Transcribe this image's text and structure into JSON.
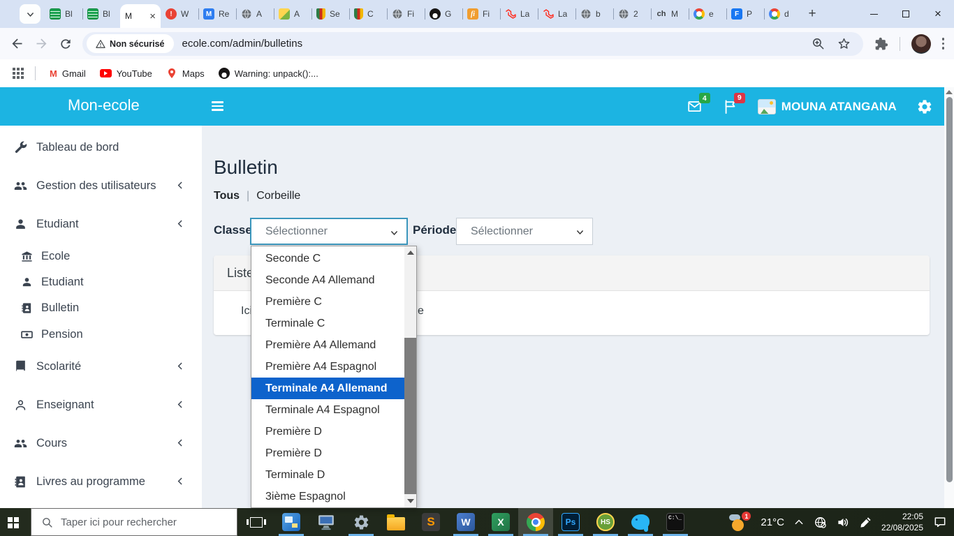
{
  "colors": {
    "appbar_teal": "#1cb4e2",
    "dropdown_highlight": "#0d63cc",
    "badge_green": "#28a745",
    "badge_red": "#dc3545",
    "select_focus_border": "#3a96bc"
  },
  "browser": {
    "tabs": [
      {
        "icon": "sheet-green",
        "label": "Bl"
      },
      {
        "icon": "sheet-green",
        "label": "Bl"
      },
      {
        "icon": "none",
        "label": "M",
        "active": true,
        "close": "×"
      },
      {
        "icon": "error-red",
        "icon_text": "!",
        "label": "W"
      },
      {
        "icon": "malwarebytes",
        "icon_text": "M",
        "label": "Re"
      },
      {
        "icon": "globe",
        "label": "A"
      },
      {
        "icon": "pencil-badge",
        "label": "A"
      },
      {
        "icon": "crest",
        "label": "Se"
      },
      {
        "icon": "crest",
        "label": "C"
      },
      {
        "icon": "globe",
        "label": "Fi"
      },
      {
        "icon": "github",
        "label": "G"
      },
      {
        "icon": "fi-orange",
        "icon_text": "fi",
        "label": "Fi"
      },
      {
        "icon": "laravel",
        "label": "La"
      },
      {
        "icon": "laravel",
        "label": "La"
      },
      {
        "icon": "globe",
        "label": "b"
      },
      {
        "icon": "globe",
        "label": "2"
      },
      {
        "icon": "ch-text",
        "icon_text": "ch",
        "label": "M"
      },
      {
        "icon": "google",
        "label": "e"
      },
      {
        "icon": "facebook",
        "icon_text": "F",
        "label": "P"
      },
      {
        "icon": "google",
        "label": "d"
      }
    ],
    "new_tab_label": "+",
    "url_bar": {
      "security_chip": "Non sécurisé",
      "url": "ecole.com/admin/bulletins"
    },
    "bookmarks": [
      {
        "icon": "gmail",
        "icon_text": "M",
        "label": "Gmail"
      },
      {
        "icon": "youtube",
        "label": "YouTube"
      },
      {
        "icon": "maps",
        "label": "Maps"
      },
      {
        "icon": "github",
        "label": "Warning: unpack():..."
      }
    ]
  },
  "app": {
    "brand": "Mon-ecole",
    "header": {
      "messages_badge": "4",
      "alerts_badge": "9",
      "user_name": "MOUNA ATANGANA"
    },
    "sidebar": {
      "items": [
        {
          "label": "Tableau de bord",
          "icon": "wrench"
        },
        {
          "label": "Gestion des utilisateurs",
          "icon": "users",
          "chevron": true
        },
        {
          "label": "Etudiant",
          "icon": "user",
          "chevron": true
        },
        {
          "label": "Ecole",
          "icon": "bank",
          "sub": true
        },
        {
          "label": "Etudiant",
          "icon": "user",
          "sub": true
        },
        {
          "label": "Bulletin",
          "icon": "address-book",
          "sub": true
        },
        {
          "label": "Pension",
          "icon": "money-bill",
          "sub": true
        },
        {
          "label": "Scolarité",
          "icon": "book",
          "chevron": true
        },
        {
          "label": "Enseignant",
          "icon": "user-outline",
          "chevron": true
        },
        {
          "label": "Cours",
          "icon": "users",
          "chevron": true
        },
        {
          "label": "Livres au programme",
          "icon": "address-book",
          "chevron": true
        }
      ]
    },
    "page": {
      "title": "Bulletin",
      "filters": {
        "all": "Tous",
        "separator": "|",
        "trash": "Corbeille"
      },
      "form": {
        "classe_label": "Classe",
        "classe_value": "Sélectionner",
        "periode_label": "Période",
        "periode_value": "Sélectionner"
      },
      "card": {
        "header_visible_text": "Liste",
        "body_visible_start": "Ici",
        "body_visible_end": "e"
      }
    },
    "class_dropdown": {
      "options": [
        "Seconde C",
        "Seconde A4 Allemand",
        "Première C",
        "Terminale C",
        "Première A4 Allemand",
        "Première A4 Espagnol",
        "Terminale A4 Allemand",
        "Terminale A4 Espagnol",
        "Première D",
        "Première D",
        "Terminale D",
        "3ième Espagnol"
      ],
      "highlighted_index": 6,
      "highlighted_value": "Terminale A4 Allemand"
    }
  },
  "taskbar": {
    "search_placeholder": "Taper ici pour rechercher",
    "app_glyphs": {
      "sublime": "S",
      "word": "W",
      "excel": "X",
      "photoshop": "Ps",
      "heidisql": "HS",
      "terminal": "C:\\_"
    },
    "tray": {
      "weather_badge": "1",
      "temperature": "21°C",
      "time": "22:05",
      "date": "22/08/2025"
    }
  }
}
